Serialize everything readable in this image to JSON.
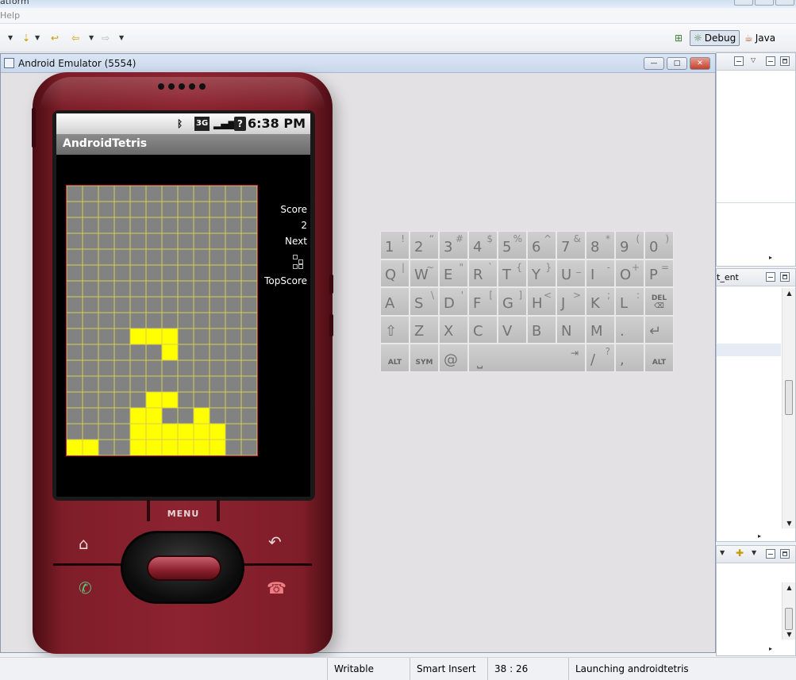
{
  "ide": {
    "window_title": "atform",
    "menu": [
      "Help"
    ],
    "perspectives": [
      {
        "label": "Debug",
        "active": true,
        "icon": "bug-icon"
      },
      {
        "label": "Java",
        "active": false,
        "icon": "java-icon"
      }
    ],
    "outline_tab": "t_ent"
  },
  "emulator": {
    "title": "Android Emulator (5554)",
    "controls": {
      "minimize": "—",
      "maximize": "□",
      "close": "✕"
    }
  },
  "android": {
    "time": "6:38 PM",
    "status_icons": [
      "bluetooth-icon",
      "3g-icon",
      "signal-icon",
      "battery-unknown-icon"
    ],
    "status_icon_labels": [
      "ᛒ",
      "3G",
      "▂▄▆",
      "?"
    ],
    "app_title": "AndroidTetris",
    "side_panel": {
      "score_label": "Score",
      "score_value": "2",
      "next_label": "Next",
      "topscore_label": "TopScore"
    },
    "board": {
      "cols": 12,
      "rows": 17,
      "filled_color": "#ffff00",
      "empty_color": "#828282",
      "grid_color": "#d7cf4e",
      "filled_rows": [
        "............",
        "............",
        "............",
        "............",
        "............",
        "............",
        "............",
        "............",
        "............",
        "....###.....",
        "......#.....",
        "............",
        "............",
        ".....##.....",
        "....##..#...",
        "....######..",
        "##..######.."
      ]
    }
  },
  "hardware": {
    "menu_label": "MENU",
    "icons": {
      "home": "⌂",
      "back": "↶",
      "call": "✆",
      "end_call": "☎"
    }
  },
  "keyboard": {
    "rows": [
      [
        {
          "main": "1",
          "sup": "!"
        },
        {
          "main": "2",
          "sup": "“"
        },
        {
          "main": "3",
          "sup": "#"
        },
        {
          "main": "4",
          "sup": "$"
        },
        {
          "main": "5",
          "sup": "%"
        },
        {
          "main": "6",
          "sup": "^"
        },
        {
          "main": "7",
          "sup": "&"
        },
        {
          "main": "8",
          "sup": "*"
        },
        {
          "main": "9",
          "sup": "("
        },
        {
          "main": "0",
          "sup": ")"
        }
      ],
      [
        {
          "main": "Q",
          "sup": "|"
        },
        {
          "main": "W",
          "sup": "~"
        },
        {
          "main": "E",
          "sup": "\""
        },
        {
          "main": "R",
          "sup": "`"
        },
        {
          "main": "T",
          "sup": "{"
        },
        {
          "main": "Y",
          "sup": "}"
        },
        {
          "main": "U",
          "sup": "_"
        },
        {
          "main": "I",
          "sup": "-"
        },
        {
          "main": "O",
          "sup": "+"
        },
        {
          "main": "P",
          "sup": "="
        }
      ],
      [
        {
          "main": "A",
          "sup": ""
        },
        {
          "main": "S",
          "sup": "\\"
        },
        {
          "main": "D",
          "sup": "'"
        },
        {
          "main": "F",
          "sup": "["
        },
        {
          "main": "G",
          "sup": "]"
        },
        {
          "main": "H",
          "sup": "<"
        },
        {
          "main": "J",
          "sup": ">"
        },
        {
          "main": "K",
          "sup": ";"
        },
        {
          "main": "L",
          "sup": ":"
        },
        {
          "small": "DEL ⌫"
        }
      ],
      [
        {
          "main": "⇧",
          "sup": ""
        },
        {
          "main": "Z",
          "sup": ""
        },
        {
          "main": "X",
          "sup": ""
        },
        {
          "main": "C",
          "sup": ""
        },
        {
          "main": "V",
          "sup": ""
        },
        {
          "main": "B",
          "sup": ""
        },
        {
          "main": "N",
          "sup": ""
        },
        {
          "main": "M",
          "sup": ""
        },
        {
          "main": ".",
          "sup": ""
        },
        {
          "main": "↵",
          "sup": ""
        }
      ],
      [
        {
          "small": "ALT"
        },
        {
          "small": "SYM"
        },
        {
          "main": "@",
          "sup": ""
        },
        {
          "space": true,
          "main": "⎵",
          "arrow": "⇥"
        },
        {
          "main": "/",
          "sup": "?"
        },
        {
          "main": ",",
          "sup": ""
        },
        {
          "small": "ALT"
        }
      ]
    ]
  },
  "status_bar": {
    "writable": "Writable",
    "insert_mode": "Smart Insert",
    "position": "38 : 26",
    "message": "Launching androidtetris"
  }
}
